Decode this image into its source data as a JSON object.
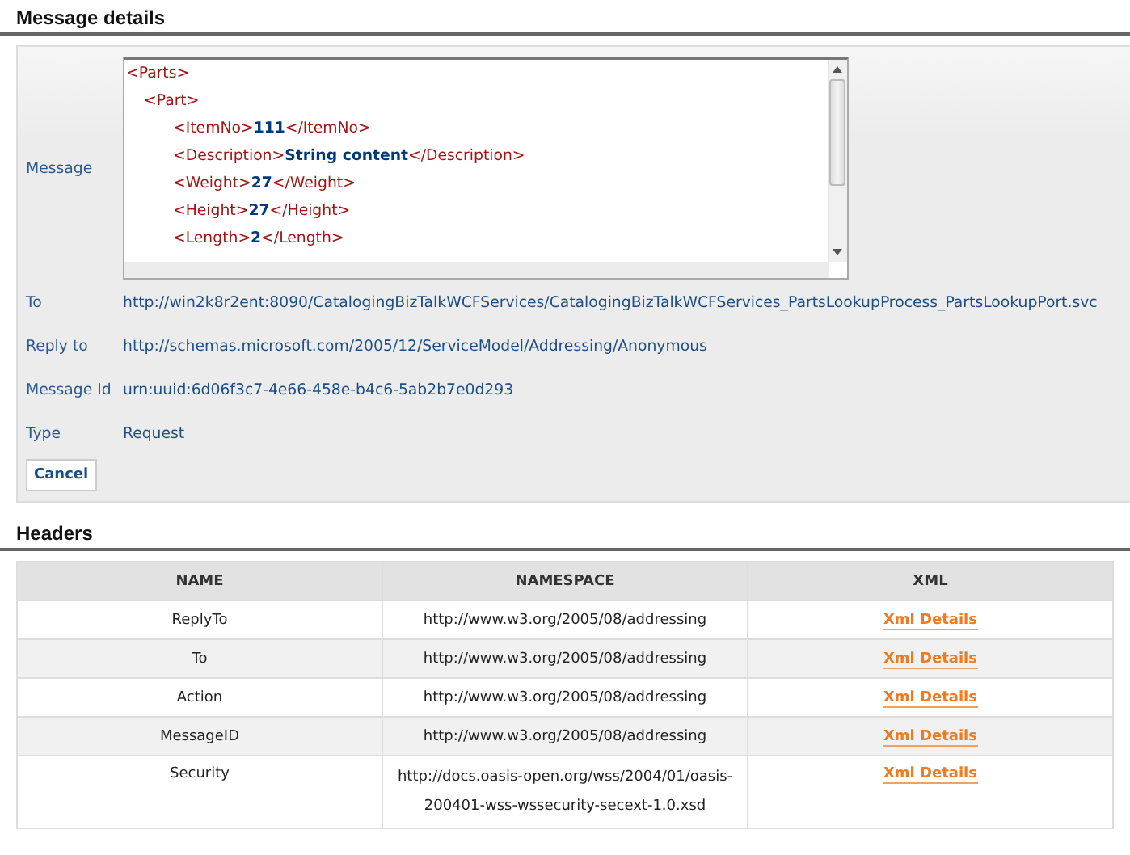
{
  "message_details": {
    "title": "Message details",
    "message_label": "Message",
    "xml": [
      {
        "open": "<Parts>",
        "children": [
          {
            "open": "<Part>",
            "children": [
              {
                "open": "<ItemNo>",
                "value": "111",
                "close": "</ItemNo>"
              },
              {
                "open": "<Description>",
                "value": "String content",
                "close": "</Description>"
              },
              {
                "open": "<Weight>",
                "value": "27",
                "close": "</Weight>"
              },
              {
                "open": "<Height>",
                "value": "27",
                "close": "</Height>"
              },
              {
                "open": "<Length>",
                "value": "2",
                "close": "</Length>"
              }
            ]
          }
        ]
      }
    ],
    "fields": [
      {
        "label": "To",
        "value": "http://win2k8r2ent:8090/CatalogingBizTalkWCFServices/CatalogingBizTalkWCFServices_PartsLookupProcess_PartsLookupPort.svc"
      },
      {
        "label": "Reply to",
        "value": "http://schemas.microsoft.com/2005/12/ServiceModel/Addressing/Anonymous"
      },
      {
        "label": "Message Id",
        "value": "urn:uuid:6d06f3c7-4e66-458e-b4c6-5ab2b7e0d293"
      },
      {
        "label": "Type",
        "value": "Request"
      }
    ],
    "cancel_button": "Cancel"
  },
  "headers": {
    "title": "Headers",
    "columns": [
      "NAME",
      "NAMESPACE",
      "XML"
    ],
    "rows": [
      {
        "name": "ReplyTo",
        "namespace": "http://www.w3.org/2005/08/addressing",
        "xml": "Xml Details"
      },
      {
        "name": "To",
        "namespace": "http://www.w3.org/2005/08/addressing",
        "xml": "Xml Details"
      },
      {
        "name": "Action",
        "namespace": "http://www.w3.org/2005/08/addressing",
        "xml": "Xml Details"
      },
      {
        "name": "MessageID",
        "namespace": "http://www.w3.org/2005/08/addressing",
        "xml": "Xml Details"
      },
      {
        "name": "Security",
        "namespace": "http://docs.oasis-open.org/wss/2004/01/oasis-200401-wss-wssecurity-secext-1.0.xsd",
        "xml": "Xml Details"
      }
    ]
  }
}
